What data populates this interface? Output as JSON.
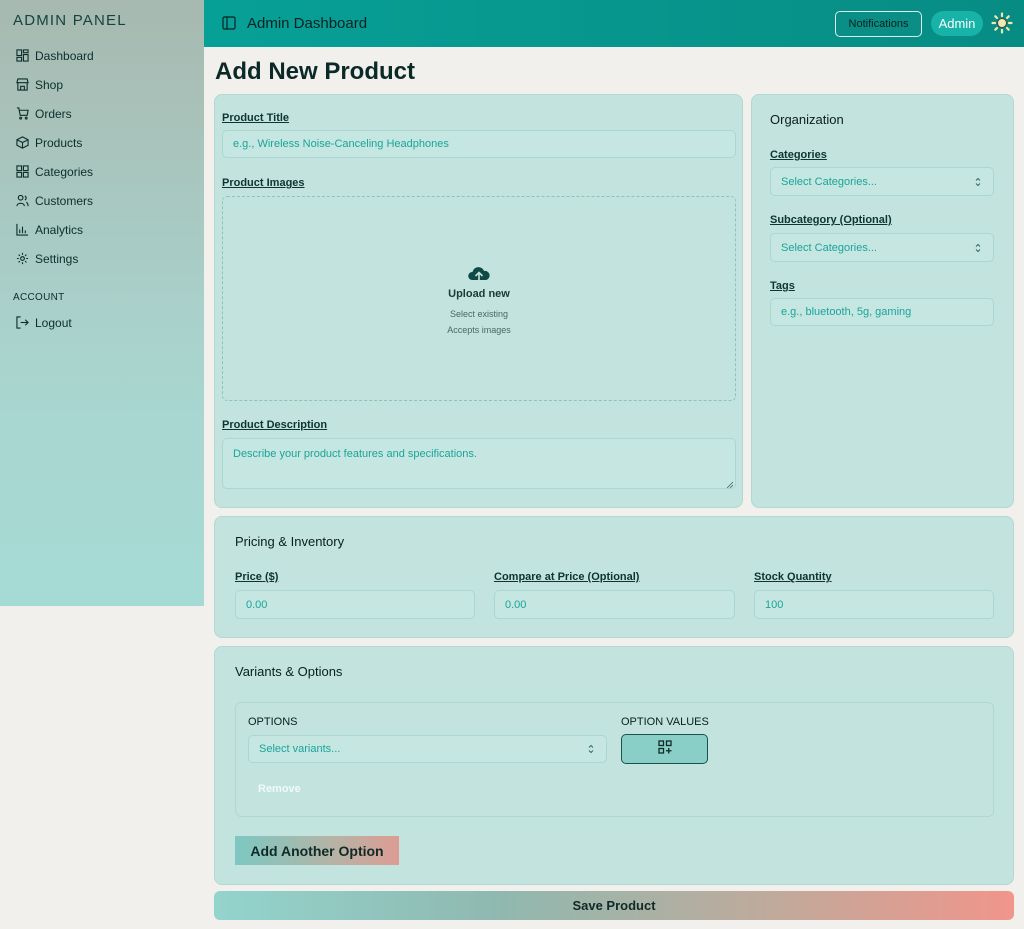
{
  "sidebar": {
    "brand": "ADMIN PANEL",
    "items": [
      {
        "label": "Dashboard",
        "icon": "dashboard-icon"
      },
      {
        "label": "Shop",
        "icon": "store-icon"
      },
      {
        "label": "Orders",
        "icon": "cart-icon"
      },
      {
        "label": "Products",
        "icon": "box-icon"
      },
      {
        "label": "Categories",
        "icon": "grid-icon"
      },
      {
        "label": "Customers",
        "icon": "users-icon"
      },
      {
        "label": "Analytics",
        "icon": "chart-icon"
      },
      {
        "label": "Settings",
        "icon": "gear-icon"
      }
    ],
    "account_label": "ACCOUNT",
    "logout_label": "Logout"
  },
  "topbar": {
    "title": "Admin Dashboard",
    "notifications_label": "Notifications",
    "user_label": "Admin"
  },
  "page": {
    "title": "Add New Product"
  },
  "product": {
    "title_label": "Product Title",
    "title_placeholder": "e.g., Wireless Noise-Canceling Headphones",
    "images_label": "Product Images",
    "upload_title": "Upload new",
    "upload_select": "Select existing",
    "upload_accepts": "Accepts images",
    "description_label": "Product Description",
    "description_placeholder": "Describe your product features and specifications."
  },
  "organization": {
    "heading": "Organization",
    "categories_label": "Categories",
    "categories_value": "Select Categories...",
    "subcategory_label": "Subcategory (Optional)",
    "subcategory_value": "Select Categories...",
    "tags_label": "Tags",
    "tags_placeholder": "e.g., bluetooth, 5g, gaming"
  },
  "pricing": {
    "heading": "Pricing & Inventory",
    "price_label": "Price ($)",
    "price_value": "0.00",
    "compare_label": "Compare at Price (Optional)",
    "compare_value": "0.00",
    "stock_label": "Stock Quantity",
    "stock_value": "100"
  },
  "variants": {
    "heading": "Variants & Options",
    "options_label": "OPTIONS",
    "options_value": "Select variants...",
    "option_values_label": "OPTION VALUES",
    "remove_label": "Remove",
    "add_option_label": "Add Another Option"
  },
  "actions": {
    "save_label": "Save Product"
  },
  "colors": {
    "accent": "#07a097",
    "card": "#c3e3de",
    "gradient_end": "#f1958b"
  }
}
